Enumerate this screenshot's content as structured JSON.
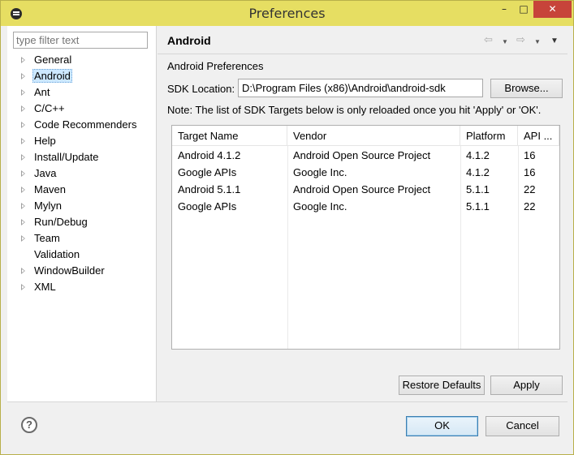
{
  "window": {
    "title": "Preferences",
    "controls": {
      "minimize": "–",
      "maximize": "□",
      "close": "✕"
    }
  },
  "sidebar": {
    "filter_placeholder": "type filter text",
    "items": [
      {
        "label": "General",
        "expandable": true
      },
      {
        "label": "Android",
        "expandable": true,
        "selected": true
      },
      {
        "label": "Ant",
        "expandable": true
      },
      {
        "label": "C/C++",
        "expandable": true
      },
      {
        "label": "Code Recommenders",
        "expandable": true
      },
      {
        "label": "Help",
        "expandable": true
      },
      {
        "label": "Install/Update",
        "expandable": true
      },
      {
        "label": "Java",
        "expandable": true
      },
      {
        "label": "Maven",
        "expandable": true
      },
      {
        "label": "Mylyn",
        "expandable": true
      },
      {
        "label": "Run/Debug",
        "expandable": true
      },
      {
        "label": "Team",
        "expandable": true
      },
      {
        "label": "Validation",
        "expandable": false
      },
      {
        "label": "WindowBuilder",
        "expandable": true
      },
      {
        "label": "XML",
        "expandable": true
      }
    ]
  },
  "page": {
    "title": "Android",
    "nav_icons": [
      "back-arrow-icon",
      "dropdown-icon",
      "forward-arrow-icon",
      "dropdown-icon",
      "view-menu-icon"
    ],
    "section_label": "Android Preferences",
    "sdk_label": "SDK Location:",
    "sdk_value": "D:\\Program Files (x86)\\Android\\android-sdk",
    "browse_label": "Browse...",
    "note": "Note: The list of SDK Targets below is only reloaded once you hit 'Apply' or 'OK'.",
    "table": {
      "headers": [
        "Target Name",
        "Vendor",
        "Platform",
        "API ..."
      ],
      "rows": [
        [
          "Android 4.1.2",
          "Android Open Source Project",
          "4.1.2",
          "16"
        ],
        [
          "Google APIs",
          "Google Inc.",
          "4.1.2",
          "16"
        ],
        [
          "Android 5.1.1",
          "Android Open Source Project",
          "5.1.1",
          "22"
        ],
        [
          "Google APIs",
          "Google Inc.",
          "5.1.1",
          "22"
        ]
      ]
    },
    "restore_label": "Restore Defaults",
    "apply_label": "Apply"
  },
  "footer": {
    "help_icon": "?",
    "ok_label": "OK",
    "cancel_label": "Cancel"
  },
  "colors": {
    "titlebar": "#e6de62",
    "close_button": "#c7443a",
    "selection": "#cde8ff"
  }
}
